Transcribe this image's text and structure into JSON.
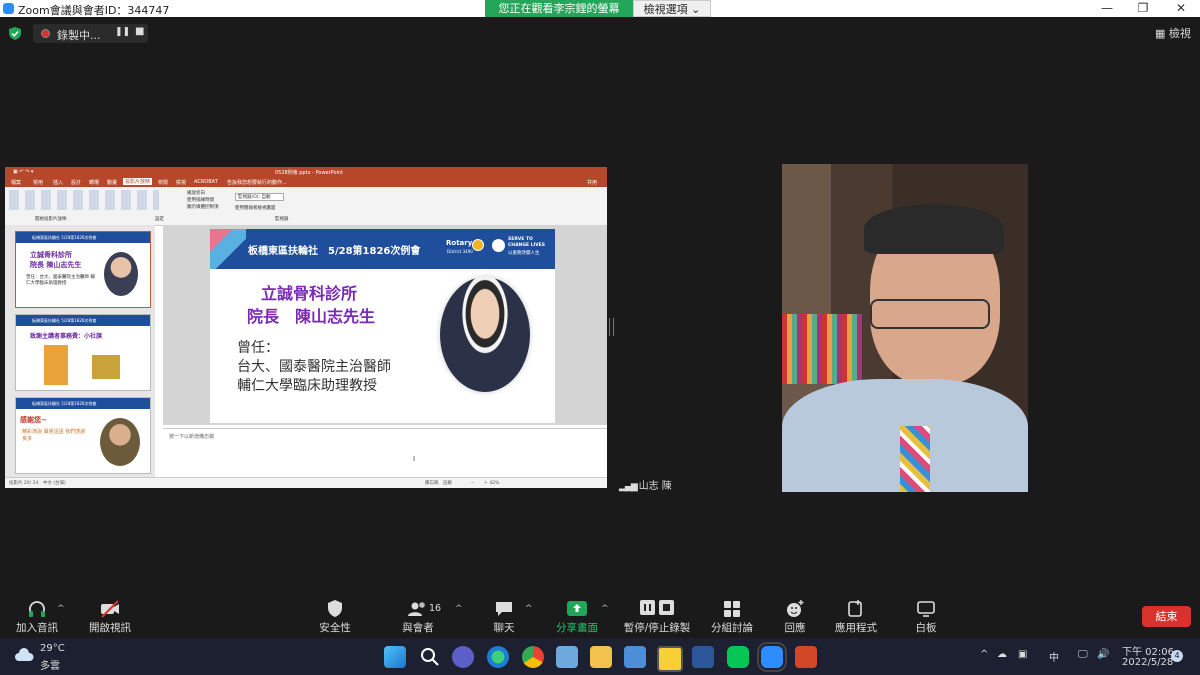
{
  "window": {
    "title": "Zoom會議與會者ID：344747",
    "min": "—",
    "restore": "❐",
    "close": "✕"
  },
  "share_banner": {
    "text": "您正在觀看李宗鋰的螢幕",
    "view_options": "檢視選項 ⌄"
  },
  "recording": {
    "label": "錄製中...",
    "pause": "❚❚",
    "stop": "■"
  },
  "view_button": {
    "label": "▦ 檢視"
  },
  "powerpoint": {
    "file_title": "0528例會.pptx - PowerPoint",
    "tabs": [
      "檔案",
      "常用",
      "插入",
      "設計",
      "轉場",
      "動畫",
      "投影片放映",
      "校閱",
      "檢視",
      "ACROBAT"
    ],
    "search": "告訴我您想要執行的動作...",
    "share": "共用",
    "ribbon_groups": [
      "開始投影片放映",
      "設定",
      "監視器"
    ],
    "ribbon_options": [
      "播放旁白",
      "使用排練時間",
      "顯示媒體控制項"
    ],
    "monitor_label": "監視器(O): 自動",
    "presenter_view": "使用簡報者檢視畫面",
    "thumbs": [
      {
        "num": "20",
        "hdr": "板橋東區扶輪社 5/28第1826次例會",
        "line1": "立誠骨科診所",
        "line2": "院長 陳山志先生",
        "body": "曾任：台大、國泰醫院主治醫師 輔仁大學臨床助理教授"
      },
      {
        "num": "21",
        "hdr": "板橋東區扶輪社 5/28第1826次例會",
        "line1": "致謝主講者事務費：小社旗",
        "line2": "",
        "body": ""
      },
      {
        "num": "22",
        "hdr": "板橋東區扶輪社 5/28第1826次例會",
        "line1": "感謝您~",
        "line2": "精彩演說 寶貴話語 我們感謝良多",
        "body": ""
      }
    ],
    "slide": {
      "header": "板橋東區扶輪社　5/28第1826次例會",
      "rotary": "Rotary",
      "district": "District 3490",
      "serve1": "SERVE TO",
      "serve2": "CHANGE LIVES",
      "serve3": "以服務改變人生",
      "clinic": "立誠骨科診所",
      "director": "院長　陳山志先生",
      "former": "曾任：",
      "job1": "台大、國泰醫院主治醫師",
      "job2": "輔仁大學臨床助理教授"
    },
    "notes": "按一下以新增備忘稿",
    "status_left": "投影片 20/ 24　中文 (台灣)",
    "status_right": "備忘稿　註解　　　　－　　＋ 42%"
  },
  "participant": {
    "name": "山志 陳"
  },
  "toolbar": {
    "audio": "加入音訊",
    "video": "開啟視訊",
    "security": "安全性",
    "participants": "與會者",
    "participants_count": "16",
    "chat": "聊天",
    "share": "分享畫面",
    "record": "暫停/停止錄製",
    "breakout": "分組討論",
    "reactions": "回應",
    "apps": "應用程式",
    "whiteboard": "白板",
    "end": "結束"
  },
  "taskbar": {
    "weather_temp": "29°C",
    "weather_desc": "多雲",
    "time": "下午 02:06",
    "date": "2022/5/28",
    "notif": "4",
    "input_method": "中",
    "colors": {
      "accent": "#2d8cff",
      "share_green": "#23a55a",
      "end_red": "#d9322e",
      "ppt_red": "#b7472a"
    }
  }
}
